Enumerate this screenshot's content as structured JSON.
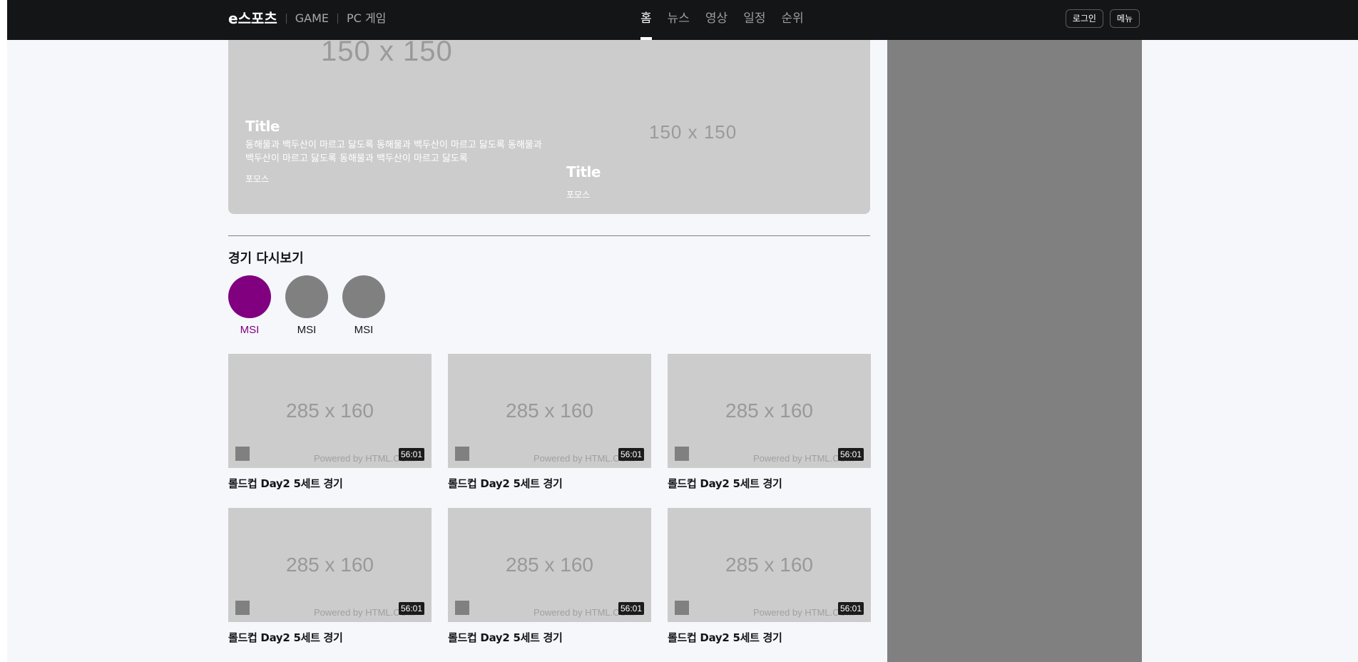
{
  "header": {
    "logo": "e스포츠",
    "links": [
      "GAME",
      "PC 게임"
    ],
    "nav": [
      {
        "label": "홈",
        "active": true
      },
      {
        "label": "뉴스",
        "active": false
      },
      {
        "label": "영상",
        "active": false
      },
      {
        "label": "일정",
        "active": false
      },
      {
        "label": "순위",
        "active": false
      }
    ],
    "login_label": "로그인",
    "menu_label": "메뉴"
  },
  "hero": {
    "placeholder_large": "150 x 150",
    "placeholder_small": "150 x 150",
    "cards": [
      {
        "title": "Title",
        "description": "동해물과 백두산이 마르고 닳도록 동해물과 백두산이 마르고 닳도록 동해물과 백두산이 마르고 닳도록 동해물과 백두산이 마르고 닳도록",
        "tag": "포모스"
      },
      {
        "title": "Title",
        "tag": "포모스"
      }
    ]
  },
  "replay": {
    "section_title": "경기 다시보기",
    "leagues": [
      {
        "name": "MSI",
        "active": true
      },
      {
        "name": "MSI",
        "active": false
      },
      {
        "name": "MSI",
        "active": false
      }
    ],
    "videos": [
      {
        "placeholder": "285 x 160",
        "powered": "Powered by HTML.COM",
        "duration": "56:01",
        "title": "롤드컵 Day2 5세트 경기"
      },
      {
        "placeholder": "285 x 160",
        "powered": "Powered by HTML.COM",
        "duration": "56:01",
        "title": "롤드컵 Day2 5세트 경기"
      },
      {
        "placeholder": "285 x 160",
        "powered": "Powered by HTML.COM",
        "duration": "56:01",
        "title": "롤드컵 Day2 5세트 경기"
      },
      {
        "placeholder": "285 x 160",
        "powered": "Powered by HTML.COM",
        "duration": "56:01",
        "title": "롤드컵 Day2 5세트 경기"
      },
      {
        "placeholder": "285 x 160",
        "powered": "Powered by HTML.COM",
        "duration": "56:01",
        "title": "롤드컵 Day2 5세트 경기"
      },
      {
        "placeholder": "285 x 160",
        "powered": "Powered by HTML.COM",
        "duration": "56:01",
        "title": "롤드컵 Day2 5세트 경기"
      }
    ]
  },
  "colors": {
    "header_bg": "#141517",
    "active_league": "#800080",
    "placeholder_gray": "#cccccc",
    "aside_gray": "#808080",
    "page_bg": "#f6f7fb"
  }
}
